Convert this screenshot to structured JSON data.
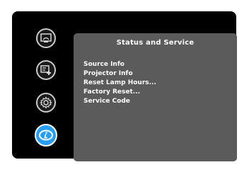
{
  "sidebar": {
    "items": [
      {
        "icon": "image-settings-icon",
        "active": false
      },
      {
        "icon": "advanced-setup-icon",
        "active": false
      },
      {
        "icon": "gear-icon",
        "active": false
      },
      {
        "icon": "info-icon",
        "active": true
      }
    ]
  },
  "panel": {
    "title": "Status and Service",
    "items": [
      {
        "label": "Source Info"
      },
      {
        "label": "Projector Info"
      },
      {
        "label": "Reset Lamp Hours..."
      },
      {
        "label": "Factory Reset..."
      },
      {
        "label": "Service Code"
      }
    ]
  },
  "colors": {
    "screen_bg": "#000000",
    "panel_bg": "#5b5b5b",
    "accent": "#2a9df4",
    "text": "#ffffff"
  }
}
